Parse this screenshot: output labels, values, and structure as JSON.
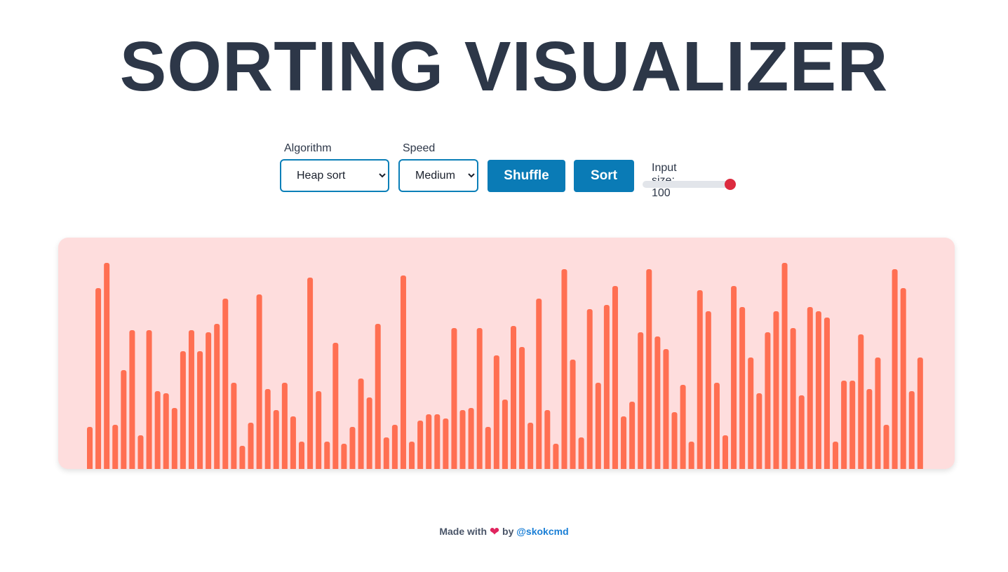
{
  "header": {
    "title": "SORTING VISUALIZER"
  },
  "controls": {
    "algorithm_label": "Algorithm",
    "algorithm_value": "Heap sort",
    "speed_label": "Speed",
    "speed_value": "Medium",
    "shuffle_label": "Shuffle",
    "sort_label": "Sort",
    "input_size_text": "Input size: 100",
    "input_size_value": 100,
    "input_size_max": 100
  },
  "colors": {
    "title": "#2d3748",
    "accent_button": "#0a7bb6",
    "bar": "#ff6f52",
    "panel_bg": "#fedddd",
    "slider_thumb": "#dc2b3f"
  },
  "chart_data": {
    "type": "bar",
    "values": [
      20,
      86,
      98,
      21,
      47,
      66,
      16,
      66,
      37,
      36,
      29,
      56,
      66,
      56,
      65,
      69,
      81,
      41,
      11,
      22,
      83,
      38,
      28,
      41,
      25,
      13,
      91,
      37,
      13,
      60,
      12,
      20,
      43,
      34,
      69,
      15,
      21,
      92,
      13,
      23,
      26,
      26,
      24,
      67,
      28,
      29,
      67,
      20,
      54,
      33,
      68,
      58,
      22,
      81,
      28,
      12,
      95,
      52,
      15,
      76,
      41,
      78,
      87,
      25,
      32,
      65,
      95,
      63,
      57,
      27,
      40,
      13,
      85,
      75,
      41,
      16,
      87,
      77,
      53,
      36,
      65,
      75,
      98,
      67,
      35,
      77,
      75,
      72,
      13,
      42,
      42,
      64,
      38,
      53,
      21,
      95,
      86,
      37,
      53
    ]
  },
  "footer": {
    "made_with": "Made with",
    "heart": "❤",
    "by": "by",
    "author": "@skokcmd"
  }
}
